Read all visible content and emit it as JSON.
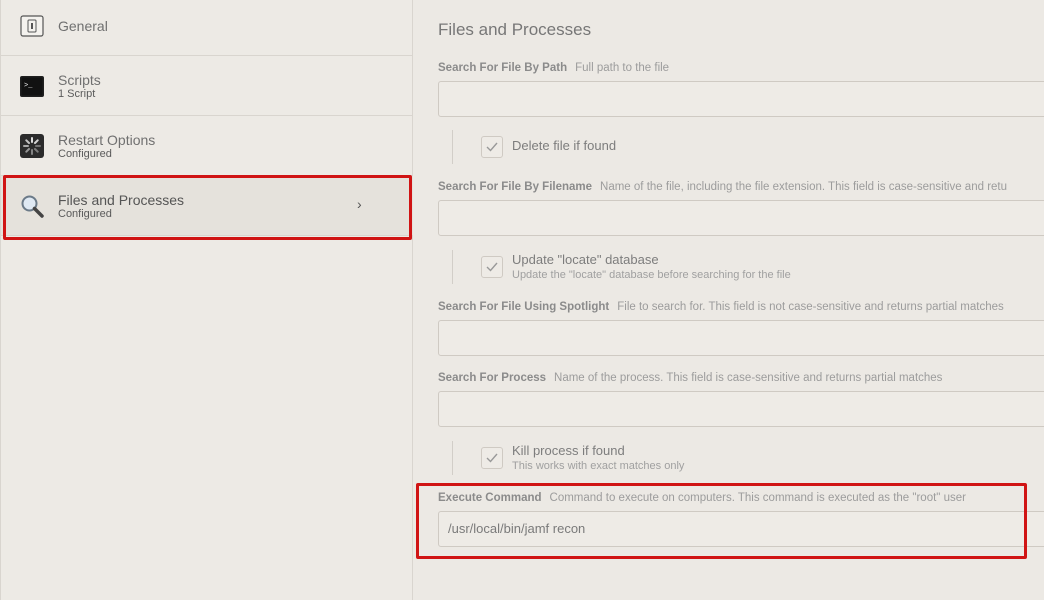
{
  "sidebar": {
    "items": [
      {
        "label": "General",
        "sub": "",
        "icon": "general-icon"
      },
      {
        "label": "Scripts",
        "sub": "1 Script",
        "icon": "terminal-icon"
      },
      {
        "label": "Restart Options",
        "sub": "Configured",
        "icon": "spinner-icon"
      },
      {
        "label": "Files and Processes",
        "sub": "Configured",
        "icon": "magnifier-icon",
        "chevron": "›"
      }
    ]
  },
  "main": {
    "title": "Files and Processes",
    "search_path": {
      "label": "Search For File By Path",
      "hint": "Full path to the file",
      "value": ""
    },
    "delete_file": {
      "label": "Delete file if found",
      "checked": true
    },
    "search_filename": {
      "label": "Search For File By Filename",
      "hint": "Name of the file, including the file extension. This field is case-sensitive and retu",
      "value": ""
    },
    "update_locate": {
      "label": "Update \"locate\" database",
      "sub": "Update the \"locate\" database before searching for the file",
      "checked": true
    },
    "search_spotlight": {
      "label": "Search For File Using Spotlight",
      "hint": "File to search for. This field is not case-sensitive and returns partial matches",
      "value": ""
    },
    "search_process": {
      "label": "Search For Process",
      "hint": "Name of the process. This field is case-sensitive and returns partial matches",
      "value": ""
    },
    "kill_process": {
      "label": "Kill process if found",
      "sub": "This works with exact matches only",
      "checked": true
    },
    "execute_command": {
      "label": "Execute Command",
      "hint": "Command to execute on computers. This command is executed as the \"root\" user",
      "value": "/usr/local/bin/jamf recon"
    }
  },
  "colors": {
    "highlight": "#d01414",
    "background": "#ece9e4"
  }
}
